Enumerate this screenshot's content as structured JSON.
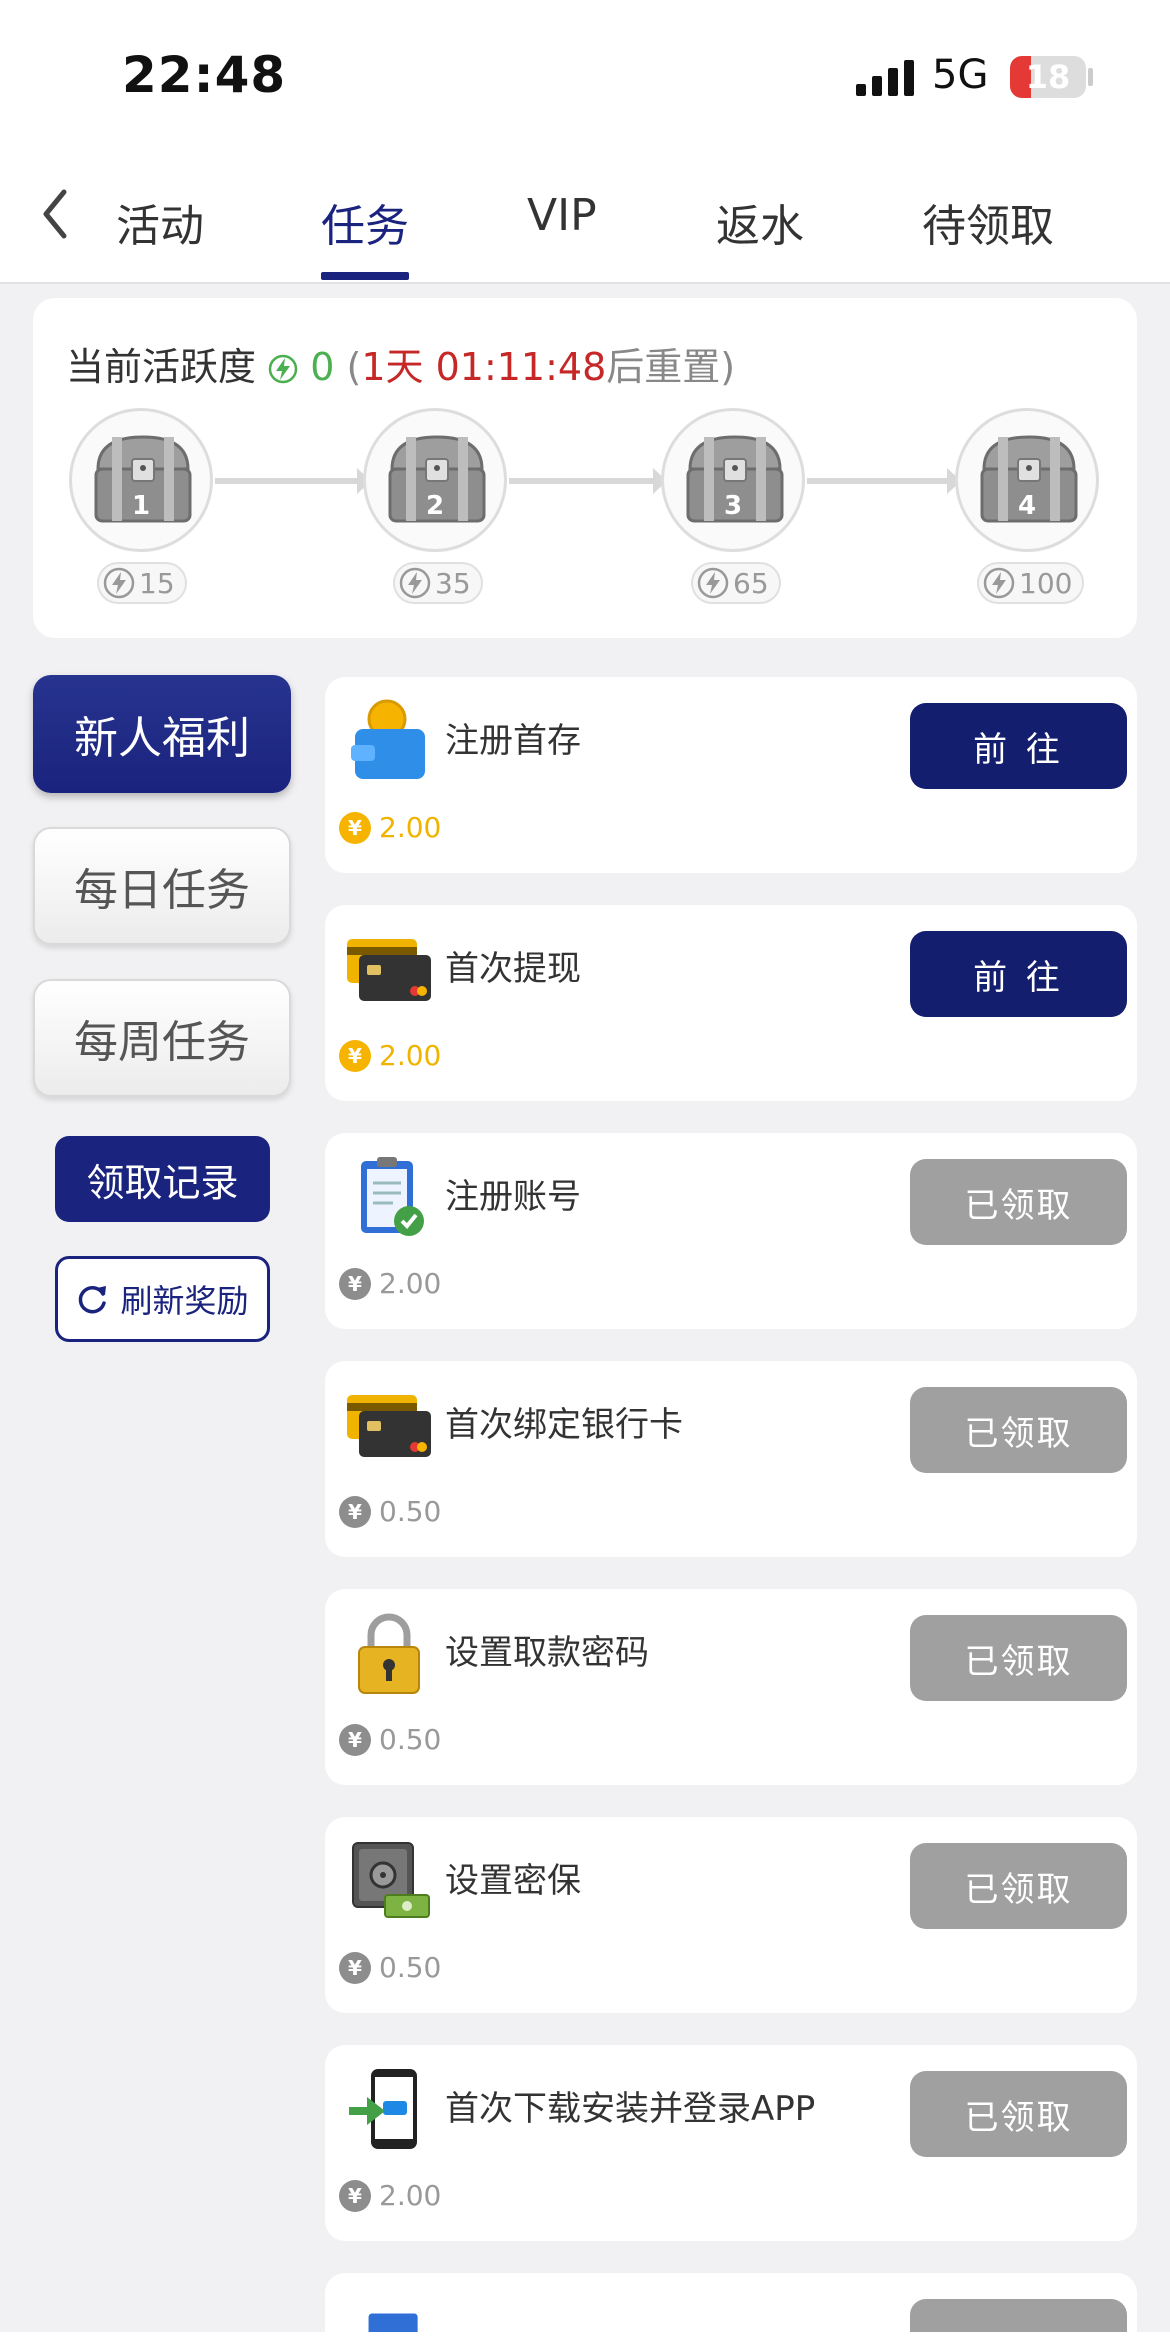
{
  "status_bar": {
    "time": "22:48",
    "network": "5G",
    "battery": "18"
  },
  "tabs": [
    {
      "label": "活动"
    },
    {
      "label": "任务"
    },
    {
      "label": "VIP"
    },
    {
      "label": "返水"
    },
    {
      "label": "待领取"
    }
  ],
  "activity": {
    "label": "当前活跃度",
    "value": "0",
    "reset_days": "1天",
    "reset_time": "01:11:48",
    "reset_suffix": "后重置",
    "chests": [
      {
        "num": "1",
        "req": "15"
      },
      {
        "num": "2",
        "req": "35"
      },
      {
        "num": "3",
        "req": "65"
      },
      {
        "num": "4",
        "req": "100"
      }
    ]
  },
  "menu": {
    "items": [
      {
        "label": "新人福利"
      },
      {
        "label": "每日任务"
      },
      {
        "label": "每周任务"
      }
    ],
    "record_label": "领取记录",
    "refresh_label": "刷新奖励"
  },
  "coin_symbol": "¥",
  "tasks": [
    {
      "name": "注册首存",
      "reward": "2.00",
      "button": "前 往"
    },
    {
      "name": "首次提现",
      "reward": "2.00",
      "button": "前 往"
    },
    {
      "name": "注册账号",
      "reward": "2.00",
      "button": "已领取"
    },
    {
      "name": "首次绑定银行卡",
      "reward": "0.50",
      "button": "已领取"
    },
    {
      "name": "设置取款密码",
      "reward": "0.50",
      "button": "已领取"
    },
    {
      "name": "设置密保",
      "reward": "0.50",
      "button": "已领取"
    },
    {
      "name": "首次下载安装并登录APP",
      "reward": "2.00",
      "button": "已领取"
    }
  ],
  "colors": {
    "primary": "#1a237e",
    "gold": "#f0b400",
    "claimed": "#a0a0a0",
    "red": "#c62828",
    "green": "#4caf50"
  }
}
